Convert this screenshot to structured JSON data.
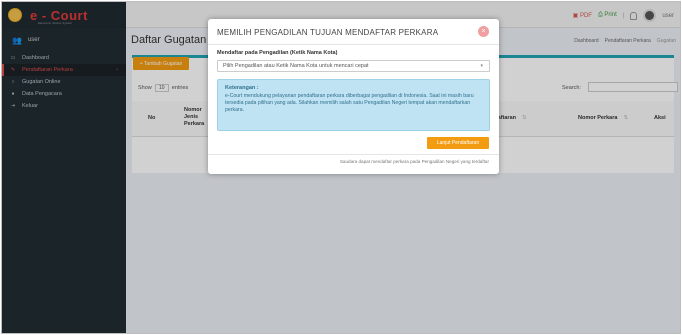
{
  "app": {
    "logo_text": "e - Court",
    "logo_subtitle": "Electronic Justice System",
    "username": "user"
  },
  "topbar": {
    "pdf_label": "PDF",
    "print_label": "Print",
    "separator": "|"
  },
  "sidebar": {
    "user_label": "user",
    "items": [
      {
        "label": "Dashboard",
        "active": false
      },
      {
        "label": "Pendaftaran Perkara",
        "active": true,
        "chevron": "‹"
      },
      {
        "label": "Gugatan Online",
        "active": false
      },
      {
        "label": "Data Pengacara",
        "active": false
      },
      {
        "label": "Keluar",
        "active": false
      }
    ]
  },
  "content": {
    "title": "Daftar Gugatan",
    "breadcrumb": {
      "home": "Dashboard",
      "section": "Pendaftaran Perkara",
      "current": "Gugatan"
    },
    "add_button": "+ Tambah Gugatan",
    "show_label": "Show",
    "show_value": "10",
    "entries_label": "entries",
    "search_label": "Search:",
    "table_headers": [
      "No",
      "Nomor Jenis Perkara",
      "Tanggal Pendaftaran",
      "Nomor Perkara",
      "Aksi"
    ]
  },
  "modal": {
    "title": "MEMILIH PENGADILAN TUJUAN MENDAFTAR PERKARA",
    "field_label": "Mendaftar pada Pengadilan (Ketik Nama Kota)",
    "select_placeholder": "Pilih Pengadilan atau Ketik Nama Kota untuk mencari cepat",
    "info_title": "Keterangan :",
    "info_text": "e-Court mendukung pelayanan pendaftaran perkara diberbagai pengadilan di Indonesia. Saat ini masih baru tersedia pada pilihan yang ada. Silahkan memilih salah satu Pengadilan Negeri tempat akan mendaftarkan perkara.",
    "next_button": "Lanjut Pendaftaran",
    "footer_note": "Saudara dapat mendaftar perkara pada Pengadilan Negeri yang terdaftar"
  }
}
